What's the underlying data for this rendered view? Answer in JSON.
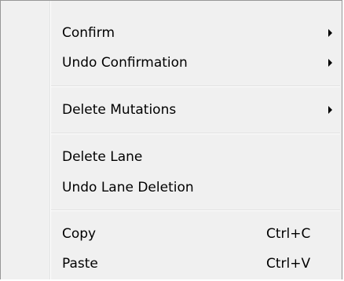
{
  "menu": {
    "items": [
      {
        "label": "Confirm",
        "has_submenu": true
      },
      {
        "label": "Undo Confirmation",
        "has_submenu": true
      },
      {
        "label": "Delete Mutations",
        "has_submenu": true
      },
      {
        "label": "Delete Lane",
        "has_submenu": false
      },
      {
        "label": "Undo Lane Deletion",
        "has_submenu": false
      },
      {
        "label": "Copy",
        "shortcut": "Ctrl+C"
      },
      {
        "label": "Paste",
        "shortcut": "Ctrl+V"
      }
    ]
  },
  "icons": {
    "submenu_arrow": "chevron-right-icon"
  },
  "colors": {
    "background": "#f0f0f0",
    "border": "#979797",
    "text": "#000000"
  }
}
